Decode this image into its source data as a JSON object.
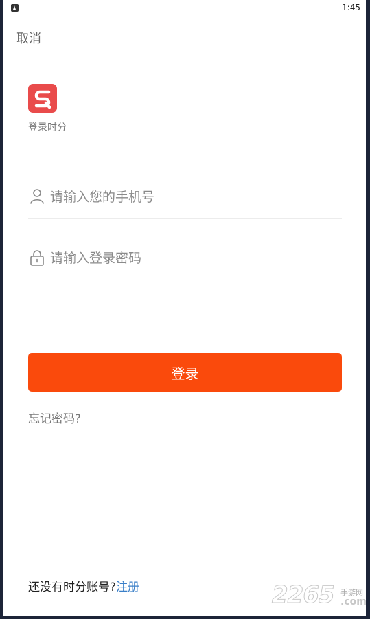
{
  "status_bar": {
    "time": "1:45"
  },
  "header": {
    "cancel_label": "取消"
  },
  "brand": {
    "logo_letter": "S",
    "name": "登录时分",
    "accent_color": "#e94b4b"
  },
  "form": {
    "phone_placeholder": "请输入您的手机号",
    "password_placeholder": "请输入登录密码",
    "login_label": "登录",
    "login_color": "#fa4a0c",
    "forgot_label": "忘记密码?"
  },
  "footer": {
    "no_account_text": "还没有时分账号?",
    "register_label": "注册"
  },
  "watermark": {
    "number": "2265",
    "site": "手游网",
    "domain": ".com"
  }
}
